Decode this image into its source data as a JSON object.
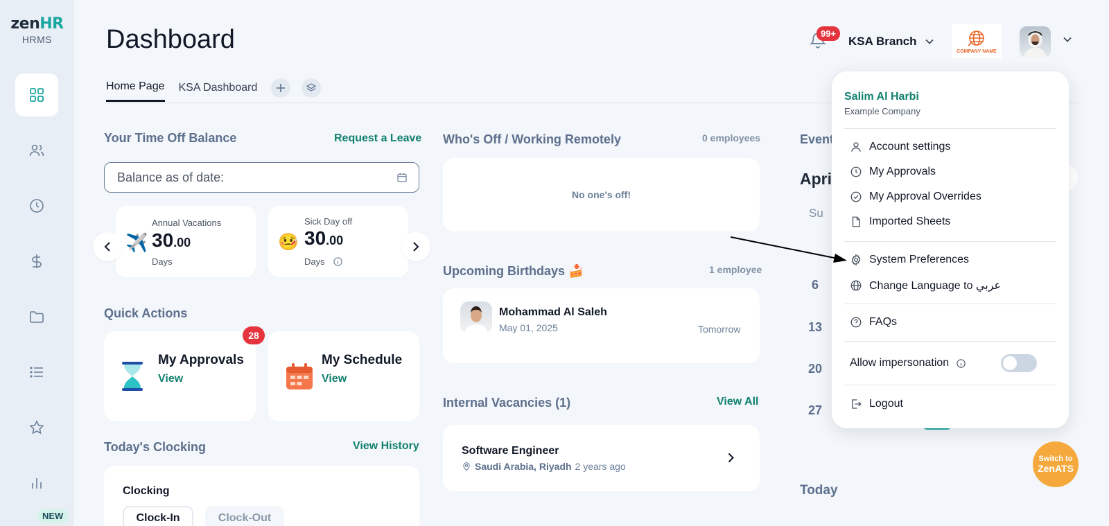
{
  "brand": {
    "logo_prefix": "zen",
    "logo_suffix": "HR",
    "subtitle": "HRMS"
  },
  "sidebar": {
    "items": [
      {
        "icon": "dashboard-grid-icon",
        "active": true
      },
      {
        "icon": "people-icon"
      },
      {
        "icon": "clock-icon"
      },
      {
        "icon": "dollar-icon"
      },
      {
        "icon": "folder-icon"
      },
      {
        "icon": "list-icon"
      },
      {
        "icon": "star-icon"
      },
      {
        "icon": "bar-chart-icon"
      }
    ],
    "new_badge": "NEW"
  },
  "header": {
    "title": "Dashboard",
    "notifications_badge": "99+",
    "branch": "KSA Branch",
    "company_logo_text": "COMPANY NAME"
  },
  "tabs": {
    "home": "Home Page",
    "ksa": "KSA Dashboard"
  },
  "time_off": {
    "title": "Your Time Off Balance",
    "request_link": "Request a Leave",
    "date_placeholder": "Balance as of date:",
    "cards": [
      {
        "label": "Annual Vacations",
        "value_int": "30",
        "value_dec": ".00",
        "unit": "Days",
        "emoji": "✈️"
      },
      {
        "label": "Sick Day off",
        "value_int": "30",
        "value_dec": ".00",
        "unit": "Days",
        "emoji": "🤒"
      }
    ]
  },
  "quick_actions": {
    "title": "Quick Actions",
    "approvals": {
      "title": "My Approvals",
      "link": "View",
      "badge": "28"
    },
    "schedule": {
      "title": "My Schedule",
      "link": "View"
    }
  },
  "clocking": {
    "title": "Today's Clocking",
    "history_link": "View History",
    "card_title": "Clocking",
    "clock_in": "Clock-In",
    "clock_out": "Clock-Out"
  },
  "whos_off": {
    "title": "Who's Off / Working Remotely",
    "count": "0 employees",
    "empty": "No one's off!"
  },
  "birthdays": {
    "title": "Upcoming Birthdays 🍰",
    "count": "1 employee",
    "person": {
      "name": "Mohammad Al Saleh",
      "date": "May 01, 2025",
      "when": "Tomorrow"
    }
  },
  "vacancies": {
    "title": "Internal Vacancies (1)",
    "view_all": "View All",
    "job": {
      "title": "Software Engineer",
      "location": "Saudi Arabia, Riyadh",
      "posted": "2 years ago"
    }
  },
  "calendar": {
    "events_title": "Event",
    "month": "Apri",
    "day_header": "Su",
    "days": [
      "6",
      "13",
      "20",
      "27"
    ],
    "today_title": "Today"
  },
  "user_menu": {
    "name": "Salim Al Harbi",
    "company": "Example Company",
    "items": [
      {
        "label": "Account settings",
        "icon": "user-icon"
      },
      {
        "label": "My Approvals",
        "icon": "clock-icon"
      },
      {
        "label": "My Approval Overrides",
        "icon": "check-circle-icon"
      },
      {
        "label": "Imported Sheets",
        "icon": "file-icon"
      },
      {
        "label": "System Preferences",
        "icon": "gear-icon"
      },
      {
        "label": "Change Language to عربي",
        "icon": "globe-icon"
      },
      {
        "label": "FAQs",
        "icon": "help-circle-icon"
      },
      {
        "label": "Logout",
        "icon": "logout-icon"
      }
    ],
    "impersonation_label": "Allow impersonation",
    "impersonation_enabled": false
  },
  "zenats": {
    "line1": "Switch to",
    "line2": "ZenATS"
  },
  "colors": {
    "accent": "#11806f",
    "badge": "#e5343d",
    "sidebar_bg": "#e8eef5",
    "page_bg": "#f3f6fa",
    "zenats": "#f5a93c"
  }
}
